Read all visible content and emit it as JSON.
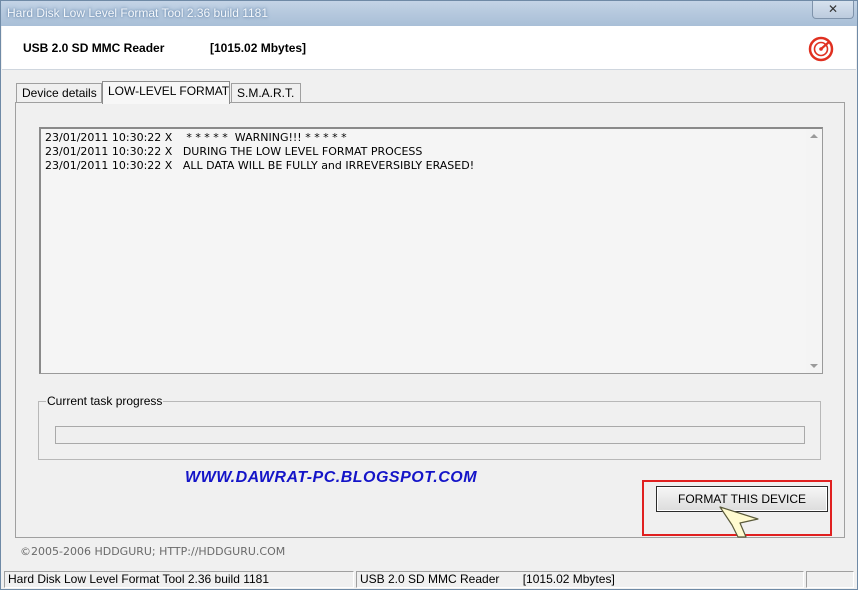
{
  "window": {
    "title": "Hard Disk Low Level Format Tool 2.36 build 1181",
    "close_glyph": "✕"
  },
  "header": {
    "device_name": "USB 2.0 SD MMC Reader",
    "device_size": "[1015.02 Mbytes]",
    "logo_icon": "hddguru-logo-icon"
  },
  "tabs": [
    {
      "label": "Device details",
      "active": false
    },
    {
      "label": "LOW-LEVEL FORMAT",
      "active": true
    },
    {
      "label": "S.M.A.R.T.",
      "active": false
    }
  ],
  "log": {
    "lines": [
      "23/01/2011 10:30:22 X    * * * * *  WARNING!!! * * * * *",
      "23/01/2011 10:30:22 X   DURING THE LOW LEVEL FORMAT PROCESS",
      "23/01/2011 10:30:22 X   ALL DATA WILL BE FULLY and IRREVERSIBLY ERASED!"
    ]
  },
  "progress": {
    "legend": "Current task progress",
    "value_percent": 0
  },
  "watermark": "WWW.DAWRAT-PC.BLOGSPOT.COM",
  "format_button": {
    "label": "FORMAT THIS DEVICE",
    "highlight_color": "#e02020"
  },
  "copyright": "©2005-2006 HDDGURU;   HTTP://HDDGURU.COM",
  "statusbar": {
    "app": "Hard Disk Low Level Format Tool 2.36 build 1181",
    "device": "USB 2.0 SD MMC Reader       [1015.02 Mbytes]",
    "extra": ""
  },
  "colors": {
    "link": "#1414c8",
    "progress_fill": "#3cb043"
  }
}
